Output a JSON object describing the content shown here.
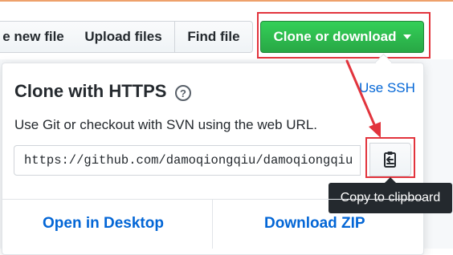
{
  "toolbar": {
    "new_file_label": "e new file",
    "upload_label": "Upload files",
    "find_label": "Find file",
    "clone_label": "Clone or download"
  },
  "clone_panel": {
    "title": "Clone with HTTPS",
    "help_symbol": "?",
    "switch_link": "Use SSH",
    "description": "Use Git or checkout with SVN using the web URL.",
    "url_value": "https://github.com/damoqiongqiu/damoqiongqiu",
    "copy_tooltip": "Copy to clipboard",
    "open_desktop_label": "Open in Desktop",
    "download_zip_label": "Download ZIP"
  },
  "colors": {
    "primary_green": "#28a745",
    "link_blue": "#0366d6",
    "annotation_red": "#e2343d",
    "tooltip_bg": "#24292e"
  },
  "icons": {
    "help": "question-circle-icon",
    "copy": "clipboard-icon",
    "dropdown": "caret-down-icon",
    "annotation": "red-arrow"
  }
}
